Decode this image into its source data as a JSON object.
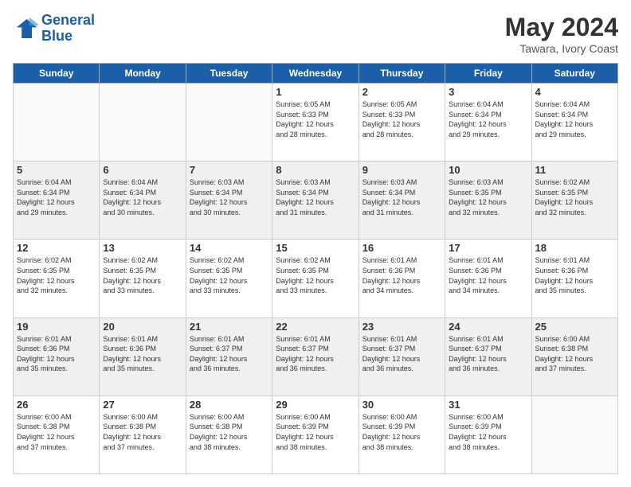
{
  "logo": {
    "line1": "General",
    "line2": "Blue"
  },
  "title": "May 2024",
  "location": "Tawara, Ivory Coast",
  "days_of_week": [
    "Sunday",
    "Monday",
    "Tuesday",
    "Wednesday",
    "Thursday",
    "Friday",
    "Saturday"
  ],
  "weeks": [
    {
      "shaded": false,
      "days": [
        {
          "num": "",
          "info": ""
        },
        {
          "num": "",
          "info": ""
        },
        {
          "num": "",
          "info": ""
        },
        {
          "num": "1",
          "info": "Sunrise: 6:05 AM\nSunset: 6:33 PM\nDaylight: 12 hours\nand 28 minutes."
        },
        {
          "num": "2",
          "info": "Sunrise: 6:05 AM\nSunset: 6:33 PM\nDaylight: 12 hours\nand 28 minutes."
        },
        {
          "num": "3",
          "info": "Sunrise: 6:04 AM\nSunset: 6:34 PM\nDaylight: 12 hours\nand 29 minutes."
        },
        {
          "num": "4",
          "info": "Sunrise: 6:04 AM\nSunset: 6:34 PM\nDaylight: 12 hours\nand 29 minutes."
        }
      ]
    },
    {
      "shaded": true,
      "days": [
        {
          "num": "5",
          "info": "Sunrise: 6:04 AM\nSunset: 6:34 PM\nDaylight: 12 hours\nand 29 minutes."
        },
        {
          "num": "6",
          "info": "Sunrise: 6:04 AM\nSunset: 6:34 PM\nDaylight: 12 hours\nand 30 minutes."
        },
        {
          "num": "7",
          "info": "Sunrise: 6:03 AM\nSunset: 6:34 PM\nDaylight: 12 hours\nand 30 minutes."
        },
        {
          "num": "8",
          "info": "Sunrise: 6:03 AM\nSunset: 6:34 PM\nDaylight: 12 hours\nand 31 minutes."
        },
        {
          "num": "9",
          "info": "Sunrise: 6:03 AM\nSunset: 6:34 PM\nDaylight: 12 hours\nand 31 minutes."
        },
        {
          "num": "10",
          "info": "Sunrise: 6:03 AM\nSunset: 6:35 PM\nDaylight: 12 hours\nand 32 minutes."
        },
        {
          "num": "11",
          "info": "Sunrise: 6:02 AM\nSunset: 6:35 PM\nDaylight: 12 hours\nand 32 minutes."
        }
      ]
    },
    {
      "shaded": false,
      "days": [
        {
          "num": "12",
          "info": "Sunrise: 6:02 AM\nSunset: 6:35 PM\nDaylight: 12 hours\nand 32 minutes."
        },
        {
          "num": "13",
          "info": "Sunrise: 6:02 AM\nSunset: 6:35 PM\nDaylight: 12 hours\nand 33 minutes."
        },
        {
          "num": "14",
          "info": "Sunrise: 6:02 AM\nSunset: 6:35 PM\nDaylight: 12 hours\nand 33 minutes."
        },
        {
          "num": "15",
          "info": "Sunrise: 6:02 AM\nSunset: 6:35 PM\nDaylight: 12 hours\nand 33 minutes."
        },
        {
          "num": "16",
          "info": "Sunrise: 6:01 AM\nSunset: 6:36 PM\nDaylight: 12 hours\nand 34 minutes."
        },
        {
          "num": "17",
          "info": "Sunrise: 6:01 AM\nSunset: 6:36 PM\nDaylight: 12 hours\nand 34 minutes."
        },
        {
          "num": "18",
          "info": "Sunrise: 6:01 AM\nSunset: 6:36 PM\nDaylight: 12 hours\nand 35 minutes."
        }
      ]
    },
    {
      "shaded": true,
      "days": [
        {
          "num": "19",
          "info": "Sunrise: 6:01 AM\nSunset: 6:36 PM\nDaylight: 12 hours\nand 35 minutes."
        },
        {
          "num": "20",
          "info": "Sunrise: 6:01 AM\nSunset: 6:36 PM\nDaylight: 12 hours\nand 35 minutes."
        },
        {
          "num": "21",
          "info": "Sunrise: 6:01 AM\nSunset: 6:37 PM\nDaylight: 12 hours\nand 36 minutes."
        },
        {
          "num": "22",
          "info": "Sunrise: 6:01 AM\nSunset: 6:37 PM\nDaylight: 12 hours\nand 36 minutes."
        },
        {
          "num": "23",
          "info": "Sunrise: 6:01 AM\nSunset: 6:37 PM\nDaylight: 12 hours\nand 36 minutes."
        },
        {
          "num": "24",
          "info": "Sunrise: 6:01 AM\nSunset: 6:37 PM\nDaylight: 12 hours\nand 36 minutes."
        },
        {
          "num": "25",
          "info": "Sunrise: 6:00 AM\nSunset: 6:38 PM\nDaylight: 12 hours\nand 37 minutes."
        }
      ]
    },
    {
      "shaded": false,
      "days": [
        {
          "num": "26",
          "info": "Sunrise: 6:00 AM\nSunset: 6:38 PM\nDaylight: 12 hours\nand 37 minutes."
        },
        {
          "num": "27",
          "info": "Sunrise: 6:00 AM\nSunset: 6:38 PM\nDaylight: 12 hours\nand 37 minutes."
        },
        {
          "num": "28",
          "info": "Sunrise: 6:00 AM\nSunset: 6:38 PM\nDaylight: 12 hours\nand 38 minutes."
        },
        {
          "num": "29",
          "info": "Sunrise: 6:00 AM\nSunset: 6:39 PM\nDaylight: 12 hours\nand 38 minutes."
        },
        {
          "num": "30",
          "info": "Sunrise: 6:00 AM\nSunset: 6:39 PM\nDaylight: 12 hours\nand 38 minutes."
        },
        {
          "num": "31",
          "info": "Sunrise: 6:00 AM\nSunset: 6:39 PM\nDaylight: 12 hours\nand 38 minutes."
        },
        {
          "num": "",
          "info": ""
        }
      ]
    }
  ]
}
